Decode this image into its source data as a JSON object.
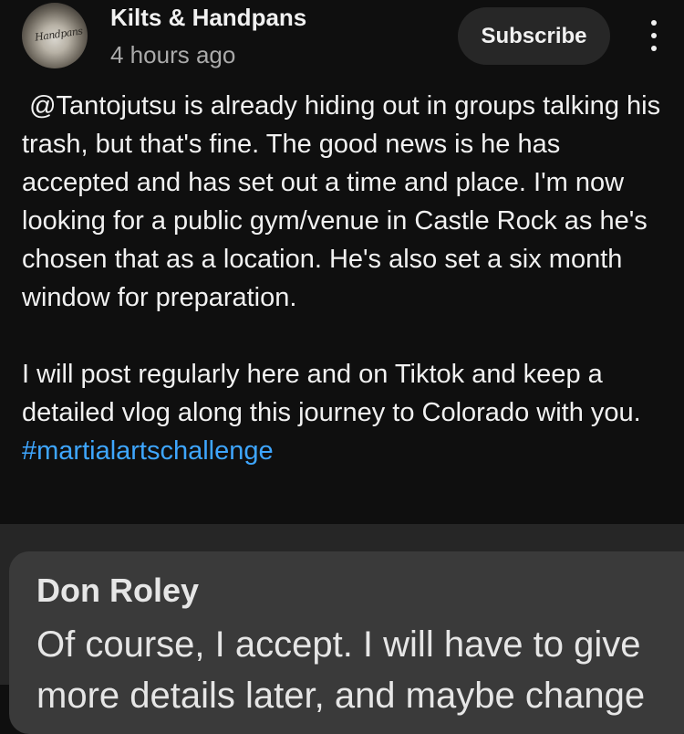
{
  "post": {
    "channel_name": "Kilts & Handpans",
    "timestamp": "4 hours ago",
    "subscribe_label": "Subscribe",
    "avatar_text": "Handpans",
    "body_text": " @Tantojutsu is already hiding out in groups talking his trash, but that's fine. The good news is he has accepted and has set out a time and place. I'm now looking for a public gym/venue in Castle Rock as he's chosen that as a location. He's also set a six month window for preparation.\n\nI will post regularly here and on Tiktok and keep a detailed vlog along this journey to Colorado with you. ",
    "hashtag": "#martialartschallenge",
    "more_icon": "kebab-menu-icon"
  },
  "reply": {
    "author": "Don Roley",
    "text": "Of course, I accept. I will have to give",
    "text_line2": "more details later, and maybe change"
  },
  "colors": {
    "background": "#0f0f0f",
    "subscribe_bg": "#272727",
    "hashtag": "#3ea6ff",
    "secondary_text": "#aaaaaa",
    "reply_panel": "#262626",
    "reply_card": "#3a3a3a"
  }
}
